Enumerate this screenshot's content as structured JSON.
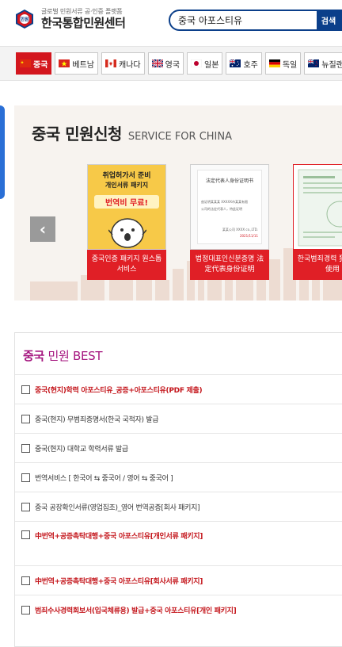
{
  "header": {
    "tagline": "글로벌 민원서류 공·인증 플랫폼",
    "site_name": "한국통합민원센터",
    "logo_badge": "민원",
    "search_value": "중국 아포스티유",
    "search_button": "검색"
  },
  "countries": [
    {
      "label": "중국",
      "icon": "china-flag-icon",
      "active": true
    },
    {
      "label": "베트남",
      "icon": "vietnam-flag-icon",
      "active": false
    },
    {
      "label": "캐나다",
      "icon": "canada-flag-icon",
      "active": false
    },
    {
      "label": "영국",
      "icon": "uk-flag-icon",
      "active": false
    },
    {
      "label": "일본",
      "icon": "japan-flag-icon",
      "active": false
    },
    {
      "label": "호주",
      "icon": "australia-flag-icon",
      "active": false
    },
    {
      "label": "독일",
      "icon": "germany-flag-icon",
      "active": false
    },
    {
      "label": "뉴질랜드",
      "icon": "newzealand-flag-icon",
      "active": false
    }
  ],
  "hero": {
    "title_ko": "중국 민원신청",
    "title_en": "SERVICE FOR CHINA",
    "prev_arrow": "‹",
    "cards": [
      {
        "img_line1": "취업허가서 준비",
        "img_line2": "개인서류 패키지",
        "img_badge": "번역비 무료!",
        "caption": "중국인증 패키지 원스톱서비스"
      },
      {
        "doc_title": "法定代表人身份证明书",
        "doc_line1": "兹证明某某某 XXXXX市某某有限",
        "doc_line2": "公司的法定代表人，特此证明",
        "doc_sign": "某某公司 XXXX co.,LTD.",
        "doc_date": "2021/11/11",
        "caption": "법정대표인신분증명 法定代表身份证明"
      },
      {
        "caption": "한국범죄경력 犯罪证书使用"
      }
    ]
  },
  "best": {
    "title_country": "중국",
    "title_rest": " 민원 BEST",
    "items": [
      {
        "label": "중국(현지)학력 아포스티유_공증+아포스티유(PDF 제출)",
        "style": "red"
      },
      {
        "label": "중국(현지) 무범죄증명서(한국 국적자) 발급",
        "style": "normal"
      },
      {
        "label": "중국(현지) 대학교 학력서류 발급",
        "style": "normal"
      },
      {
        "label": "번역서비스 [ 한국어 ⇆ 중국어 / 영어 ⇆ 중국어 ]",
        "style": "normal"
      },
      {
        "label": "중국 공장확인서류(영업집조)_영어 번역공증[회사 패키지]",
        "style": "normal"
      },
      {
        "label": "中번역+공증촉탁대행+중국 아포스티유[개인서류 패키지]",
        "style": "red-tall"
      },
      {
        "label": "中번역+공증촉탁대행+중국 아포스티유[회사서류 패키지]",
        "style": "red"
      },
      {
        "label": "범죄수사경력회보서(입국체류용) 발급+중국 아포스티유[개인 패키지]",
        "style": "red"
      }
    ]
  },
  "colors": {
    "brand_blue": "#0b3f8a",
    "active_red": "#d3161e",
    "card_red": "#e01f26",
    "best_magenta": "#a5157f"
  }
}
